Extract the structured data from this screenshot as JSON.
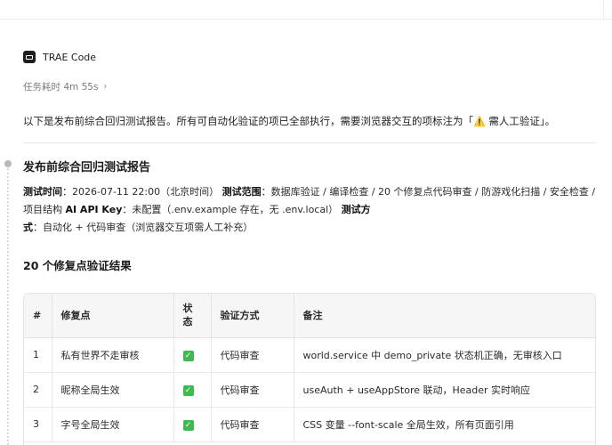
{
  "agent": {
    "name": "TRAE Code",
    "icon": "terminal-icon"
  },
  "task_duration": {
    "label": "任务耗时 4m 55s",
    "icon": "chevron-right-icon"
  },
  "intro": {
    "before": "以下是发布前综合回归测试报告。所有可自动化验证的项已全部执行，需要浏览器交互的项标注为「",
    "warn_icon": "⚠️",
    "highlight": " 需人工验证",
    "after": "」。"
  },
  "report": {
    "title": "发布前综合回归测试报告",
    "meta": [
      {
        "key": "测试时间",
        "value": "：2026-07-11 22:00（北京时间） "
      },
      {
        "key": "测试范围",
        "value": "：数据库验证 / 编译检查 / 20 个修复点代码审查 / 防游戏化扫描 / 安全检查 / 项目结构 "
      },
      {
        "key": "AI API Key",
        "value": "：未配置（.env.example 存在，无 .env.local） "
      },
      {
        "key": "测试方式",
        "value": "：自动化 + 代码审查（浏览器交互项需人工补充）"
      }
    ]
  },
  "fix_section": {
    "title": "20 个修复点验证结果",
    "columns": [
      "#",
      "修复点",
      "状态",
      "验证方式",
      "备注"
    ],
    "rows": [
      {
        "num": "1",
        "item": "私有世界不走审核",
        "status_icon": "✓",
        "method": "代码审查",
        "note": "world.service 中 demo_private 状态机正确，无审核入口"
      },
      {
        "num": "2",
        "item": "昵称全局生效",
        "status_icon": "✓",
        "method": "代码审查",
        "note": "useAuth + useAppStore 联动，Header 实时响应"
      },
      {
        "num": "3",
        "item": "字号全局生效",
        "status_icon": "✓",
        "method": "代码审查",
        "note": "CSS 变量 --font-scale 全局生效，所有页面引用"
      }
    ]
  },
  "colors": {
    "check": "#3fb950",
    "warn": "#e8a10f",
    "muted": "#7a7a7a"
  }
}
